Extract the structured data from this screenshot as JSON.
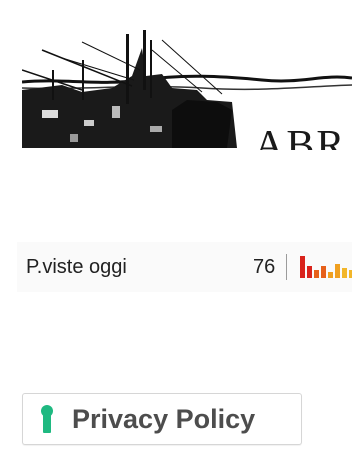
{
  "header": {
    "banner_text": "ABR",
    "banner_image": "harbor-pier-sketch-image"
  },
  "stats": {
    "label": "P.viste oggi",
    "value": "76",
    "sparkline_colors": [
      "#d9231c",
      "#e6601a",
      "#f0a020",
      "#f2b62a"
    ]
  },
  "privacy": {
    "label": "Privacy Policy",
    "icon": "keyhole-icon",
    "icon_color": "#1fb981"
  }
}
